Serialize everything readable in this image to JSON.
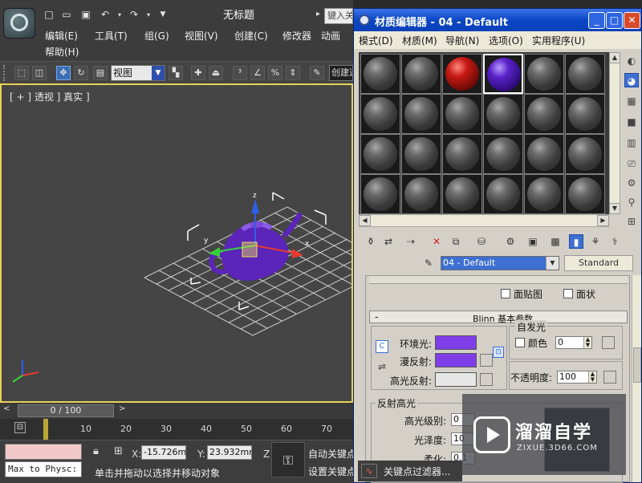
{
  "max": {
    "title": "无标题",
    "search_placeholder": "键入关",
    "menu": [
      "编辑(E)",
      "工具(T)",
      "组(G)",
      "视图(V)",
      "创建(C)",
      "修改器",
      "动画",
      "帮助(H)"
    ],
    "view_dropdown": "视图",
    "named_selection": "创建选",
    "viewport_label": "[ + ] 透视 ] 真实 ]",
    "time_slider": "0 / 100",
    "ruler_ticks": [
      "10",
      "20",
      "30",
      "40",
      "50",
      "60",
      "70"
    ],
    "maxscript_text": "Max to Physc:",
    "coords": {
      "x_label": "X:",
      "x_value": "-15.726mm",
      "y_label": "Y:",
      "y_value": "23.932mm",
      "z_label": "Z"
    },
    "status_prompt": "单击并拖动以选择并移动对象",
    "autokey": "自动关键点",
    "setkey": "设置关键点"
  },
  "material_editor": {
    "title": "材质编辑器 - 04 - Default",
    "menu": [
      "模式(D)",
      "材质(M)",
      "导航(N)",
      "选项(O)",
      "实用程序(U)"
    ],
    "slots": [
      "grey",
      "grey",
      "red",
      "purple",
      "grey",
      "grey",
      "grey",
      "grey",
      "grey",
      "grey",
      "grey",
      "grey",
      "grey",
      "grey",
      "grey",
      "grey",
      "grey",
      "grey",
      "grey",
      "grey",
      "grey",
      "grey",
      "grey",
      "grey"
    ],
    "selected_slot_index": 3,
    "material_name": "04 - Default",
    "material_type": "Standard",
    "checkbox_face_map": "面贴图",
    "checkbox_faceted": "面状",
    "rollout_title": "Blinn 基本参数",
    "self_illum": {
      "group_label": "自发光",
      "color_label": "颜色",
      "value": "0"
    },
    "ambient_label": "环境光:",
    "diffuse_label": "漫反射:",
    "specular_label": "高光反射:",
    "opacity_label": "不透明度:",
    "opacity_value": "100",
    "spec_highlights": {
      "group_label": "反射高光",
      "level_label": "高光级别:",
      "level_value": "0",
      "gloss_label": "光泽度:",
      "gloss_value": "10",
      "soften_label": "柔化:",
      "soften_value": "0.1"
    },
    "bottom_strip": "关键点过滤器..."
  },
  "colors": {
    "ambient": "#7e3ee8",
    "diffuse": "#7e3ee8",
    "specular": "#e6e6e6",
    "teapot": "#6a2fc4",
    "accent": "#3e6fd1"
  },
  "watermark": {
    "brand": "溜溜自学",
    "url": "ZIXUE.3D66.COM"
  }
}
